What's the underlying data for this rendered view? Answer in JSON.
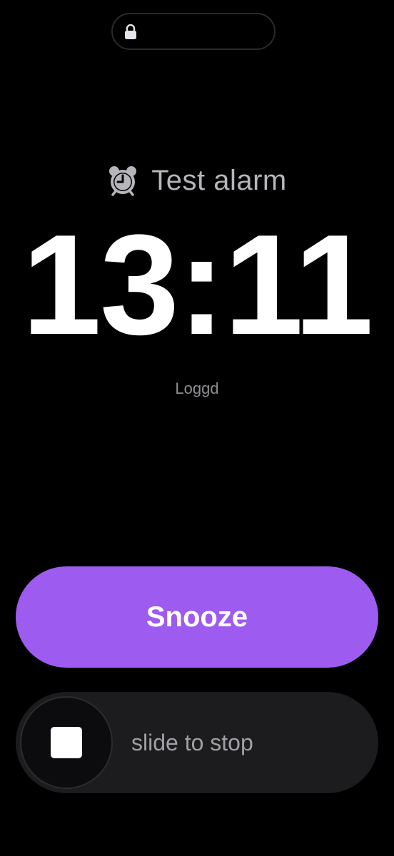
{
  "lock_screen": {
    "status_icon": "lock-icon"
  },
  "alarm": {
    "icon": "alarm-clock-icon",
    "label": "Test alarm",
    "time": "13:11",
    "subtitle": "Loggd"
  },
  "actions": {
    "snooze_label": "Snooze",
    "slide_label": "slide to stop",
    "stop_icon": "stop-icon"
  },
  "colors": {
    "background": "#000000",
    "snooze": "#9d5cef",
    "slider_track": "#1c1c1e",
    "label_grey": "#b5b5ba"
  }
}
